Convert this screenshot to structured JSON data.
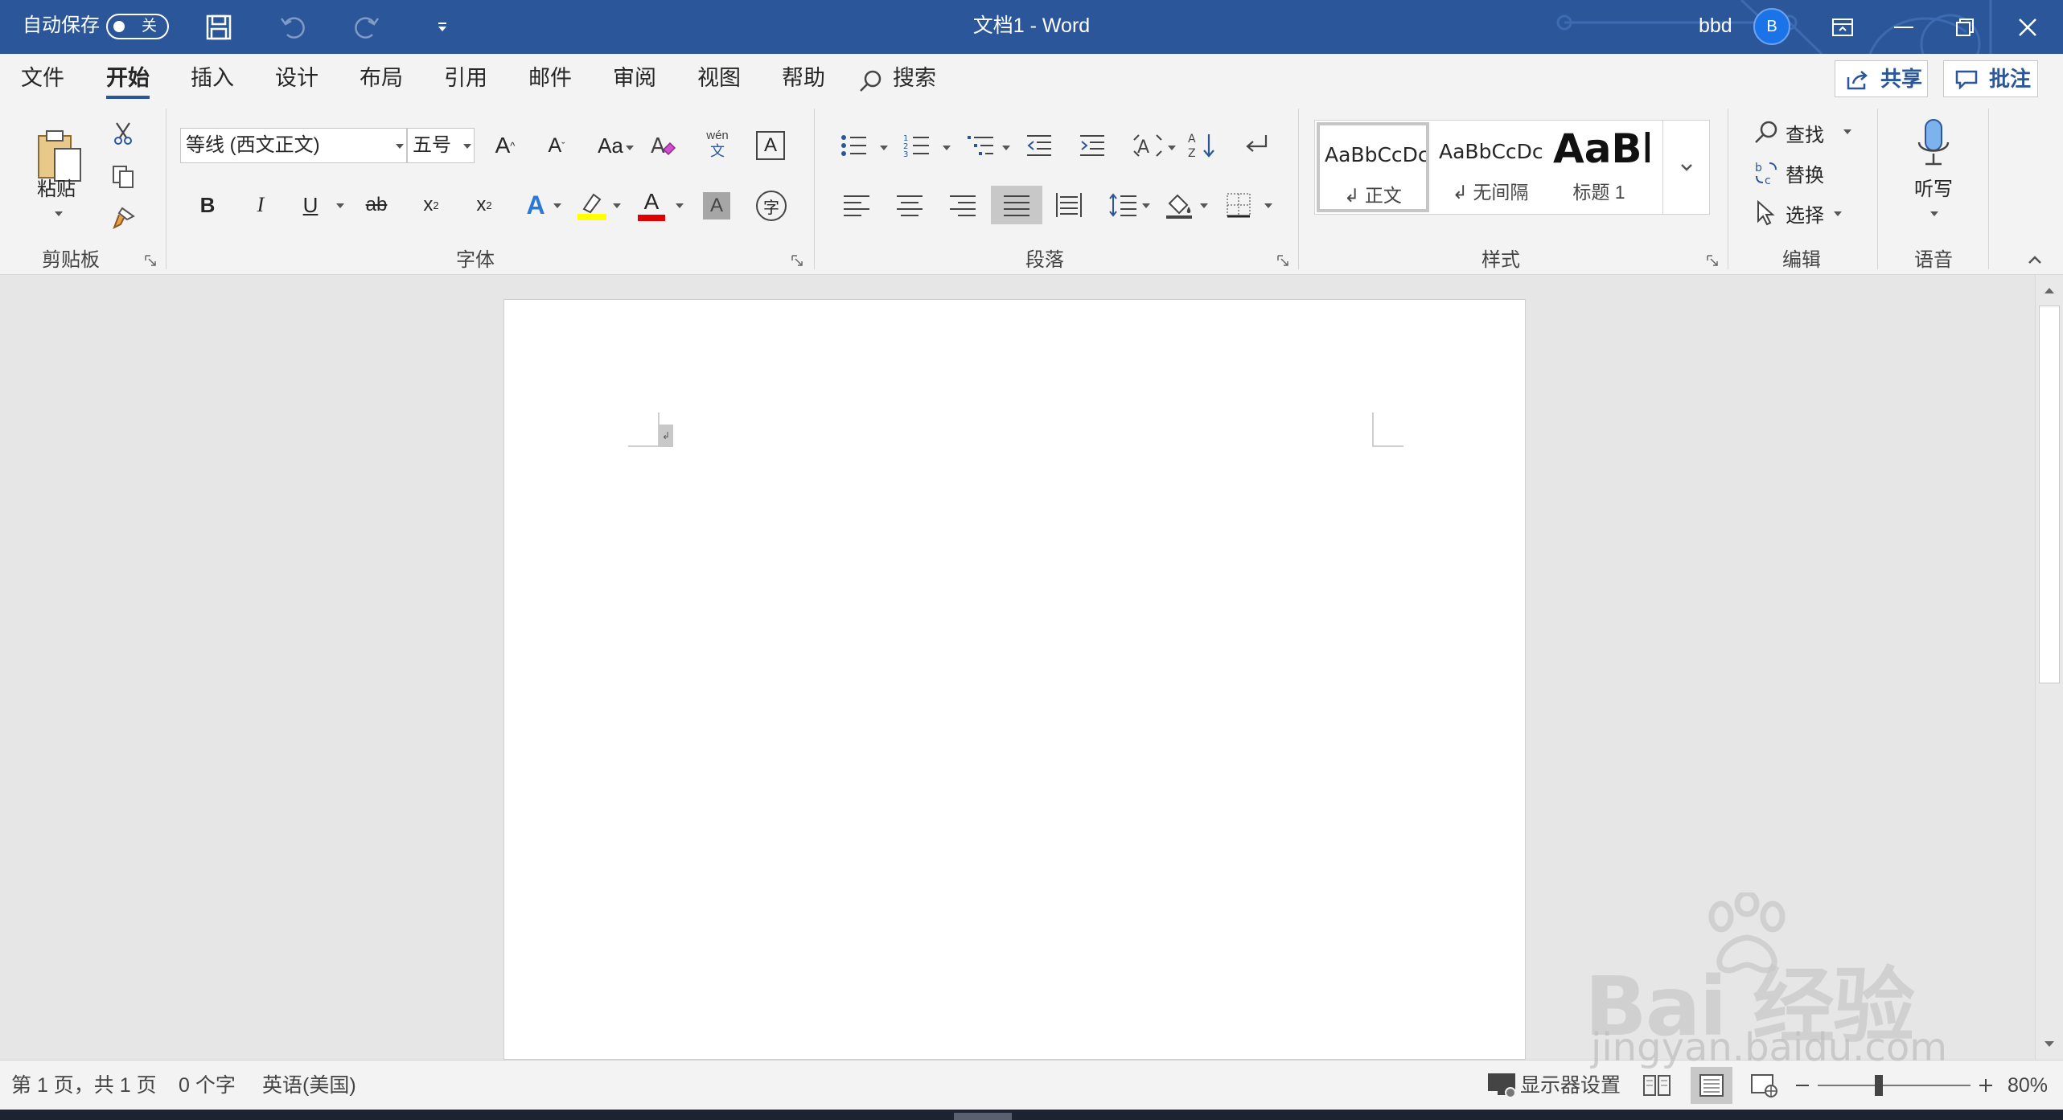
{
  "titlebar": {
    "autosave_label": "自动保存",
    "autosave_state": "关",
    "doc_title": "文档1  -  Word",
    "user_name": "bbd",
    "avatar_initial": "B",
    "bg_color": "#2b579a"
  },
  "tabs": {
    "items": [
      "文件",
      "开始",
      "插入",
      "设计",
      "布局",
      "引用",
      "邮件",
      "审阅",
      "视图",
      "帮助"
    ],
    "active": "开始",
    "search_label": "搜索",
    "share_label": "共享",
    "comment_label": "批注"
  },
  "ribbon": {
    "clipboard": {
      "label": "剪贴板",
      "paste_label": "粘贴"
    },
    "font": {
      "label": "字体",
      "font_name": "等线 (西文正文)",
      "font_size": "五号",
      "grow_label": "A",
      "shrink_label": "A",
      "case_label": "Aa",
      "phonetic_top": "wén",
      "phonetic_bottom": "文",
      "border_char_label": "A",
      "bold_label": "B",
      "italic_label": "I",
      "underline_label": "U",
      "strike_label": "ab",
      "subscript_label": "x",
      "subscript_sub": "2",
      "superscript_label": "x",
      "superscript_sup": "2",
      "effects_label": "A",
      "font_color_label": "A",
      "shading_label": "A",
      "enclosed_label": "字",
      "highlight_color": "#ffff00",
      "font_color": "#e00000"
    },
    "paragraph": {
      "label": "段落"
    },
    "styles": {
      "label": "样式",
      "items": [
        {
          "preview": "AaBbCcDc",
          "name": "↲ 正文"
        },
        {
          "preview": "AaBbCcDc",
          "name": "↲ 无间隔"
        },
        {
          "preview": "AaBl",
          "name": "标题 1"
        }
      ]
    },
    "editing": {
      "label": "编辑",
      "find_label": "查找",
      "replace_label": "替换",
      "select_label": "选择"
    },
    "voice": {
      "label": "语音",
      "dictate_label": "听写"
    }
  },
  "statusbar": {
    "page_info": "第 1 页，共 1 页",
    "word_count": "0 个字",
    "language": "英语(美国)",
    "display_settings": "显示器设置",
    "zoom": "80%",
    "zoom_fraction": 0.4
  },
  "watermark": {
    "text": "Bai 经验",
    "sub": "jingyan.baidu.com"
  }
}
